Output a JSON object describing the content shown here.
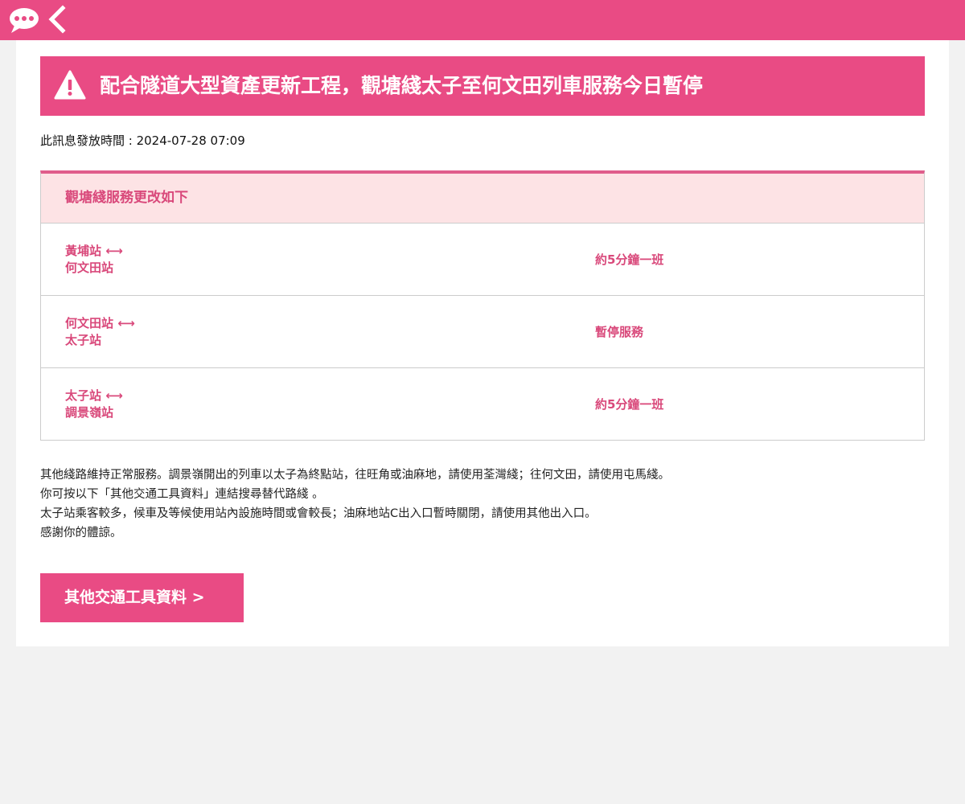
{
  "topbar": {
    "chat_icon": "chat-bubble-icon",
    "back_icon": "chevron-left-icon",
    "color": "#e94b84"
  },
  "alert": {
    "icon": "warning-icon",
    "title": "配合隧道大型資產更新工程，觀塘綫太子至何文田列車服務今日暫停"
  },
  "issued": "此訊息發放時間 : 2024-07-28 07:09",
  "service_table": {
    "header": "觀塘綫服務更改如下",
    "rows": [
      {
        "from": "黃埔站 ⟷",
        "to": "何文田站",
        "frequency": "約5分鐘一班"
      },
      {
        "from": "何文田站 ⟷",
        "to": "太子站",
        "frequency": "暫停服務"
      },
      {
        "from": "太子站 ⟷",
        "to": "調景嶺站",
        "frequency": "約5分鐘一班"
      }
    ]
  },
  "notes": [
    "其他綫路維持正常服務。調景嶺開出的列車以太子為終點站，往旺角或油麻地，請使用荃灣綫；往何文田，請使用屯馬綫。",
    "你可按以下「其他交通工具資料」連結搜尋替代路綫 。",
    "太子站乘客較多，候車及等候使用站內設施時間或會較長；油麻地站C出入口暫時關閉，請使用其他出入口。",
    "感謝你的體諒。"
  ],
  "cta_label": "其他交通工具資料 >",
  "colors": {
    "accent": "#e94b84",
    "accent_text": "#d9497b",
    "header_bg": "#fde3e5"
  }
}
